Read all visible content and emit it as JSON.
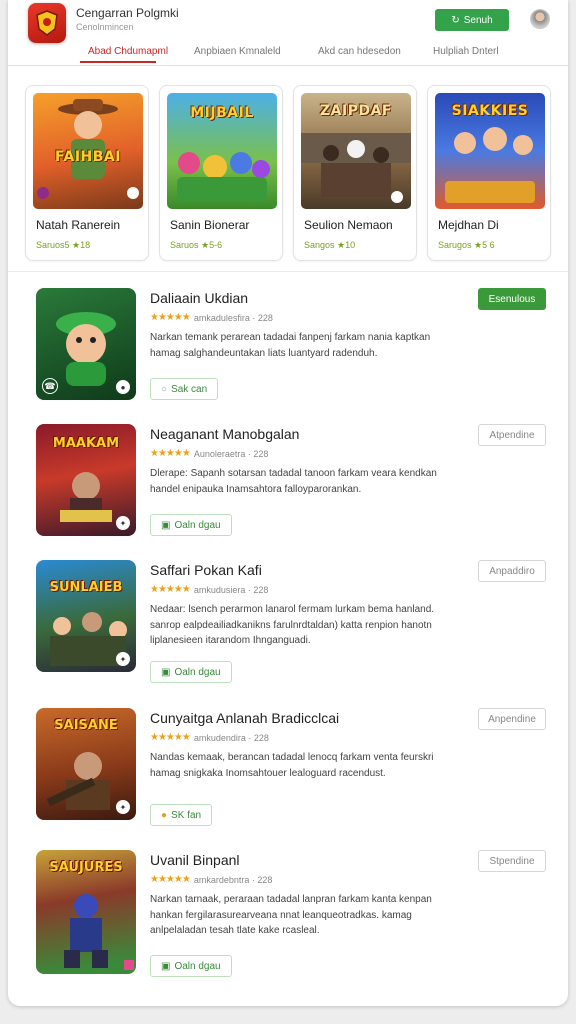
{
  "header": {
    "title": "Cengarran Polgmki",
    "subtitle": "Cenolnmincen",
    "signin_label": "Senuh",
    "tabs": [
      "Abad Chdumapml",
      "Anpbiaen Kmnaleld",
      "Akd can hdesedon",
      "Hulpliah Dnterl"
    ]
  },
  "featured": [
    {
      "art_text": "FAIHBAI",
      "name": "Natah Ranerein",
      "meta": "Saruos5 ★18"
    },
    {
      "art_text": "MIJBAIL",
      "name": "Sanin Bionerar",
      "meta": "Saruos ★5-6"
    },
    {
      "art_text": "ZAIPDAF",
      "name": "Seulion Nemaon",
      "meta": "Sangos ★10"
    },
    {
      "art_text": "SIAKKIES",
      "name": "Mejdhan Di",
      "meta": "Sarugos ★5 6"
    }
  ],
  "items": [
    {
      "name": "Daliaain Ukdian",
      "rating_text": "amkadulesfira · 228",
      "desc": "Narkan temank perarean tadadai fanpenj farkam nania kaptkan hamag salghandeuntakan liats luantyard radenduh.",
      "tag": "Sak can",
      "button": "Esenulous",
      "button_style": "primary",
      "art_text": ""
    },
    {
      "name": "Neaganant Manobgalan",
      "rating_text": "Aunoleraetra · 228",
      "desc": "Dlerape: Sapanh sotarsan tadadal tanoon farkam veara kendkan handel enipauka Inamsahtora falloyparorankan.",
      "tag": "Oaln dgau",
      "button": "Atpendine",
      "button_style": "outline",
      "art_text": "MAAKAM"
    },
    {
      "name": "Saffari Pokan Kafi",
      "rating_text": "amkudusiera · 228",
      "desc": "Nedaar: lsench perarmon lanarol fermam lurkam bema hanland. sanrop ealpdeailiadkanikns farulnrdtaldan) katta renpion hanotn liplanesieen itarandom Ihnganguadi.",
      "tag": "Oaln dgau",
      "button": "Anpaddiro",
      "button_style": "outline",
      "art_text": "SUNLAIEB"
    },
    {
      "name": "Cunyaitga Anlanah Bradicclcai",
      "rating_text": "amkudendira · 228",
      "desc": "Nandas kemaak, berancan tadadal lenocq farkam venta feurskri hamag snigkaka Inomsahtouer lealoguard racendust.",
      "tag": "SK fan",
      "button": "Anpendine",
      "button_style": "outline",
      "art_text": "SAISANE"
    },
    {
      "name": "Uvanil Binpanl",
      "rating_text": "amkardebntra · 228",
      "desc": "Narkan tarnaak, peraraan tadadal lanpran farkam kanta kenpan hankan fergilarasurearveana nnat leanqueotradkas. kamag anlpelaladan tesah tlate kake rcasleal.",
      "tag": "Oaln dgau",
      "button": "Stpendine",
      "button_style": "outline",
      "art_text": "SAUJURES"
    }
  ],
  "colors": {
    "accent_red": "#c62828",
    "brand_green": "#34a24a",
    "star": "#f0a020"
  }
}
